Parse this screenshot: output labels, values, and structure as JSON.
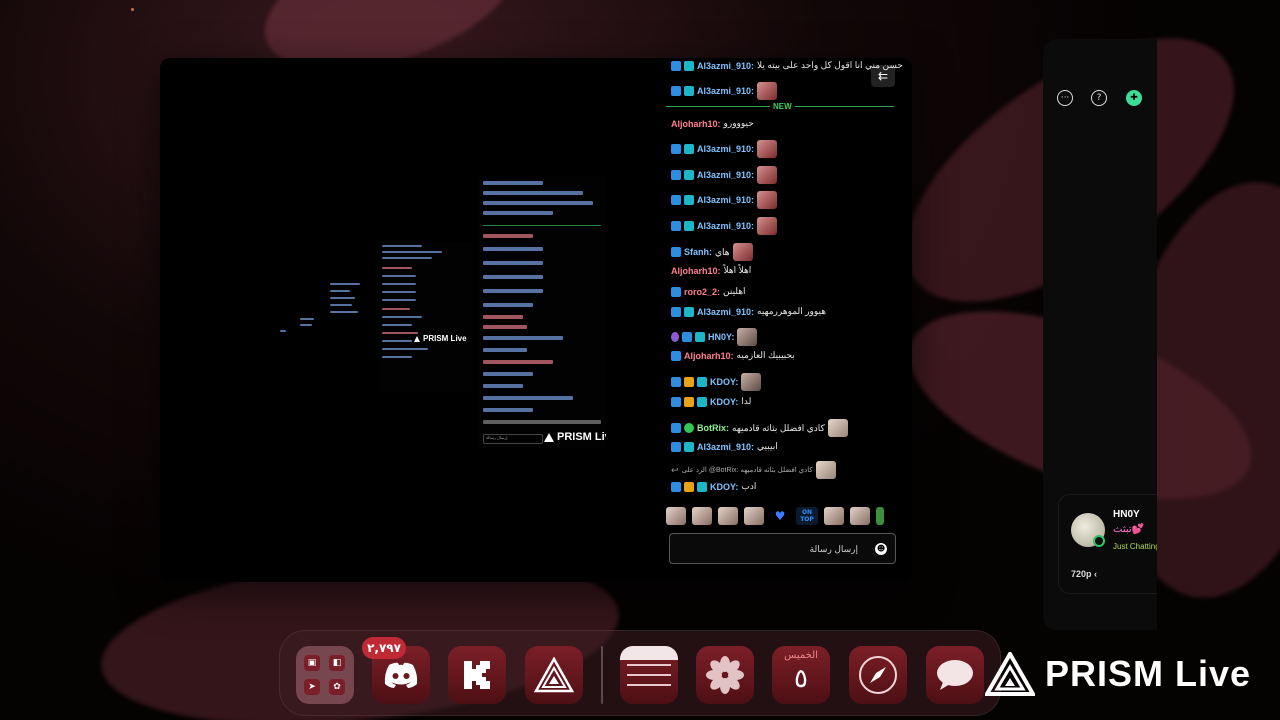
{
  "chat": {
    "messages": [
      {
        "user": "Al3azmi_910:",
        "text": "حسن مني انا اقول كل واحد على بيته يلا",
        "color": "blue",
        "badges": [
          "mod",
          "sub"
        ],
        "sticker": false
      },
      {
        "user": "Al3azmi_910:",
        "text": "",
        "color": "blue",
        "badges": [
          "mod",
          "sub"
        ],
        "sticker": true
      },
      {
        "user": "Aljoharh10:",
        "text": "حيووورو",
        "color": "pink",
        "badges": [],
        "sticker": false
      },
      {
        "user": "Al3azmi_910:",
        "text": "",
        "color": "blue",
        "badges": [
          "mod",
          "sub"
        ],
        "sticker": true
      },
      {
        "user": "Al3azmi_910:",
        "text": "",
        "color": "blue",
        "badges": [
          "mod",
          "sub"
        ],
        "sticker": true
      },
      {
        "user": "Al3azmi_910:",
        "text": "",
        "color": "blue",
        "badges": [
          "mod",
          "sub"
        ],
        "sticker": true
      },
      {
        "user": "Al3azmi_910:",
        "text": "",
        "color": "blue",
        "badges": [
          "mod",
          "sub"
        ],
        "sticker": true
      },
      {
        "user": "Sfanh:",
        "text": "هاي",
        "color": "blue",
        "badges": [
          "mod"
        ],
        "sticker": true
      },
      {
        "user": "Aljoharh10:",
        "text": "اهلاً اهلاً",
        "color": "pink",
        "badges": [],
        "sticker": false
      },
      {
        "user": "roro2_2:",
        "text": "اهلينن",
        "color": "pink",
        "badges": [
          "mod"
        ],
        "sticker": false
      },
      {
        "user": "Al3azmi_910:",
        "text": "هيوور الموهررمهيه",
        "color": "blue",
        "badges": [
          "mod",
          "sub"
        ],
        "sticker": false
      },
      {
        "user": "HN0Y:",
        "text": "",
        "color": "blue",
        "badges": [
          "mic",
          "mod",
          "sub"
        ],
        "sticker": true
      },
      {
        "user": "Aljoharh10:",
        "text": "بحبيبيك العازميه",
        "color": "pink",
        "badges": [
          "mod"
        ],
        "sticker": false
      },
      {
        "user": "KDOY:",
        "text": "",
        "color": "blue",
        "badges": [
          "mod",
          "crown",
          "sub"
        ],
        "sticker": true
      },
      {
        "user": "KDOY:",
        "text": "لدا",
        "color": "blue",
        "badges": [
          "mod",
          "crown",
          "sub"
        ],
        "sticker": false
      },
      {
        "user": "BotRix:",
        "text": "كادي افضلل بثاثه قادميهه",
        "color": "green",
        "badges": [
          "mod",
          "check"
        ],
        "sticker": true
      },
      {
        "user": "Al3azmi_910:",
        "text": "ابيبيي",
        "color": "blue",
        "badges": [
          "mod",
          "sub"
        ],
        "sticker": false
      },
      {
        "user": "",
        "text": "الرد على @BotRix: كادي افضلل بثاثه قادميهه",
        "color": "reply",
        "badges": [],
        "sticker": true
      },
      {
        "user": "KDOY:",
        "text": "ادب",
        "color": "blue",
        "badges": [
          "mod",
          "crown",
          "sub"
        ],
        "sticker": false
      }
    ],
    "new_label": "NEW",
    "input_placeholder": "إرسال رسالة",
    "emote_ontop": "ON TOP"
  },
  "nested": {
    "brand": "PRISM Live",
    "input_placeholder": "إرسال رسالة"
  },
  "side_panel": {
    "icons": [
      "more-icon",
      "help-icon",
      "gamepad-icon"
    ],
    "viewer": {
      "name": "HN0Y",
      "message": "تبثث💕",
      "status": "Just Chatting",
      "quality": "720p"
    }
  },
  "dock": {
    "notification_count": "٢,٧٩٧",
    "calendar_day": "الخميس",
    "calendar_date": "٥",
    "apps": [
      "multi-stream-folder",
      "discord",
      "kick",
      "prism",
      "notes",
      "photos",
      "calendar",
      "safari",
      "messages"
    ]
  },
  "brand": {
    "name": "PRISM Live"
  },
  "colors": {
    "accent_green": "#3dd15e",
    "user_blue": "#7fc3ff",
    "user_pink": "#ff7f8f",
    "notif_red": "#c02a35"
  }
}
